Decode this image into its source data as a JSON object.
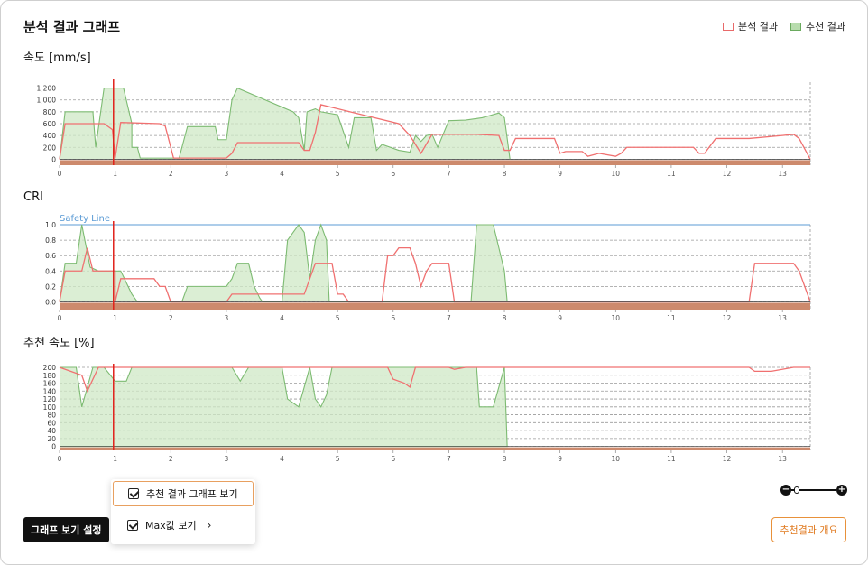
{
  "header": {
    "title": "분석 결과 그래프",
    "legend": [
      {
        "label": "분석 결과",
        "stroke": "#e86a6a",
        "fill": "#ffffff"
      },
      {
        "label": "추천 결과",
        "stroke": "#6aaa5e",
        "fill": "#b8dcae"
      }
    ]
  },
  "colors": {
    "analysis_line": "#f07070",
    "recommend_line": "#7dbb72",
    "recommend_fill": "#cfe8c6",
    "ground_band": "#cd8a6d",
    "cursor": "#e0201a",
    "safety_line": "#5b9bd5"
  },
  "charts": [
    {
      "label": "속도 [mm/s]",
      "xlim": [
        0,
        13.5
      ],
      "ylim": [
        -100,
        1300
      ],
      "yticks": [
        0,
        200,
        400,
        600,
        800,
        1000,
        1200
      ],
      "ytick_labels": [
        "0",
        "200",
        "400",
        "600",
        "800",
        "1,000",
        "1,200"
      ],
      "xticks": [
        0,
        1,
        2,
        3,
        4,
        5,
        6,
        7,
        8,
        9,
        10,
        11,
        12,
        13
      ],
      "cursor_x": 0.97,
      "band_bottom": -200,
      "recommend": [
        [
          0,
          0
        ],
        [
          0.1,
          800
        ],
        [
          0.6,
          800
        ],
        [
          0.65,
          200
        ],
        [
          0.8,
          1200
        ],
        [
          1.15,
          1200
        ],
        [
          1.3,
          600
        ],
        [
          1.3,
          200
        ],
        [
          1.4,
          200
        ],
        [
          1.45,
          20
        ],
        [
          2.15,
          20
        ],
        [
          2.3,
          550
        ],
        [
          2.8,
          550
        ],
        [
          2.85,
          330
        ],
        [
          3.0,
          330
        ],
        [
          3.1,
          1000
        ],
        [
          3.2,
          1200
        ],
        [
          4.2,
          800
        ],
        [
          4.3,
          700
        ],
        [
          4.4,
          150
        ],
        [
          4.45,
          800
        ],
        [
          4.6,
          850
        ],
        [
          4.7,
          800
        ],
        [
          5.0,
          750
        ],
        [
          5.2,
          200
        ],
        [
          5.3,
          700
        ],
        [
          5.6,
          700
        ],
        [
          5.7,
          150
        ],
        [
          5.8,
          250
        ],
        [
          6.1,
          150
        ],
        [
          6.3,
          120
        ],
        [
          6.4,
          400
        ],
        [
          6.5,
          300
        ],
        [
          6.6,
          400
        ],
        [
          6.7,
          420
        ],
        [
          6.8,
          200
        ],
        [
          7.0,
          650
        ],
        [
          7.3,
          660
        ],
        [
          7.6,
          700
        ],
        [
          7.9,
          780
        ],
        [
          8.0,
          700
        ],
        [
          8.1,
          0
        ]
      ],
      "analysis": [
        [
          0,
          0
        ],
        [
          0.1,
          600
        ],
        [
          0.8,
          600
        ],
        [
          0.95,
          500
        ],
        [
          1.0,
          20
        ],
        [
          1.1,
          620
        ],
        [
          1.8,
          600
        ],
        [
          1.9,
          560
        ],
        [
          2.0,
          200
        ],
        [
          2.05,
          20
        ],
        [
          3.0,
          20
        ],
        [
          3.1,
          100
        ],
        [
          3.2,
          280
        ],
        [
          4.3,
          280
        ],
        [
          4.4,
          150
        ],
        [
          4.5,
          150
        ],
        [
          4.6,
          450
        ],
        [
          4.7,
          920
        ],
        [
          6.1,
          600
        ],
        [
          6.3,
          400
        ],
        [
          6.5,
          100
        ],
        [
          6.7,
          420
        ],
        [
          7.5,
          420
        ],
        [
          7.9,
          400
        ],
        [
          8.0,
          150
        ],
        [
          8.1,
          150
        ],
        [
          8.2,
          350
        ],
        [
          8.9,
          350
        ],
        [
          9.0,
          100
        ],
        [
          9.1,
          130
        ],
        [
          9.4,
          130
        ],
        [
          9.5,
          50
        ],
        [
          9.7,
          100
        ],
        [
          10.0,
          50
        ],
        [
          10.1,
          100
        ],
        [
          10.2,
          200
        ],
        [
          10.9,
          200
        ],
        [
          11.4,
          200
        ],
        [
          11.5,
          100
        ],
        [
          11.6,
          100
        ],
        [
          11.8,
          350
        ],
        [
          12.4,
          350
        ],
        [
          13.0,
          400
        ],
        [
          13.2,
          420
        ],
        [
          13.3,
          350
        ],
        [
          13.5,
          0
        ]
      ]
    },
    {
      "label": "CRI",
      "xlim": [
        0,
        13.5
      ],
      "ylim": [
        -0.1,
        1.0
      ],
      "yticks": [
        0,
        0.2,
        0.4,
        0.6,
        0.8,
        1.0
      ],
      "ytick_labels": [
        "0.0",
        "0.2",
        "0.4",
        "0.6",
        "0.8",
        "1.0"
      ],
      "xticks": [
        0,
        1,
        2,
        3,
        4,
        5,
        6,
        7,
        8,
        9,
        10,
        11,
        12,
        13
      ],
      "cursor_x": 0.97,
      "band_bottom": -0.16,
      "safety_line": {
        "value": 1.0,
        "label": "Safety Line"
      },
      "recommend": [
        [
          0,
          0
        ],
        [
          0.1,
          0.5
        ],
        [
          0.3,
          0.5
        ],
        [
          0.4,
          1.0
        ],
        [
          0.55,
          0.45
        ],
        [
          0.7,
          0.4
        ],
        [
          1.1,
          0.4
        ],
        [
          1.3,
          0.1
        ],
        [
          1.4,
          0.0
        ],
        [
          2.2,
          0.0
        ],
        [
          2.3,
          0.2
        ],
        [
          3.0,
          0.2
        ],
        [
          3.1,
          0.3
        ],
        [
          3.2,
          0.5
        ],
        [
          3.4,
          0.5
        ],
        [
          3.5,
          0.2
        ],
        [
          3.6,
          0.05
        ],
        [
          3.65,
          0.0
        ],
        [
          4.0,
          0.0
        ],
        [
          4.1,
          0.8
        ],
        [
          4.3,
          1.0
        ],
        [
          4.4,
          0.9
        ],
        [
          4.5,
          0.3
        ],
        [
          4.6,
          0.8
        ],
        [
          4.7,
          1.0
        ],
        [
          4.8,
          0.8
        ],
        [
          4.85,
          0.0
        ],
        [
          7.4,
          0.0
        ],
        [
          7.5,
          1.0
        ],
        [
          7.8,
          1.0
        ],
        [
          8.0,
          0.4
        ],
        [
          8.05,
          0.0
        ]
      ],
      "analysis": [
        [
          0,
          0
        ],
        [
          0.1,
          0.4
        ],
        [
          0.4,
          0.4
        ],
        [
          0.5,
          0.7
        ],
        [
          0.6,
          0.4
        ],
        [
          1.0,
          0.4
        ],
        [
          1.0,
          0.0
        ],
        [
          1.1,
          0.3
        ],
        [
          1.7,
          0.3
        ],
        [
          1.8,
          0.2
        ],
        [
          1.9,
          0.2
        ],
        [
          2.0,
          0.0
        ],
        [
          3.0,
          0.0
        ],
        [
          3.1,
          0.1
        ],
        [
          4.4,
          0.1
        ],
        [
          4.5,
          0.3
        ],
        [
          4.6,
          0.5
        ],
        [
          4.9,
          0.5
        ],
        [
          5.0,
          0.1
        ],
        [
          5.1,
          0.1
        ],
        [
          5.2,
          0.0
        ],
        [
          5.8,
          0.0
        ],
        [
          5.9,
          0.6
        ],
        [
          6.0,
          0.6
        ],
        [
          6.1,
          0.7
        ],
        [
          6.3,
          0.7
        ],
        [
          6.4,
          0.5
        ],
        [
          6.5,
          0.2
        ],
        [
          6.6,
          0.4
        ],
        [
          6.7,
          0.5
        ],
        [
          7.0,
          0.5
        ],
        [
          7.1,
          0.0
        ],
        [
          12.4,
          0.0
        ],
        [
          12.5,
          0.5
        ],
        [
          13.2,
          0.5
        ],
        [
          13.3,
          0.4
        ],
        [
          13.4,
          0.2
        ],
        [
          13.5,
          0.0
        ]
      ]
    },
    {
      "label": "추천 속도 [%]",
      "xlim": [
        0,
        13.5
      ],
      "ylim": [
        -10,
        200
      ],
      "yticks": [
        0,
        20,
        40,
        60,
        80,
        100,
        120,
        140,
        160,
        180,
        200
      ],
      "ytick_labels": [
        "0",
        "20",
        "40",
        "60",
        "80",
        "100",
        "120",
        "140",
        "160",
        "180",
        "200"
      ],
      "xticks": [
        0,
        1,
        2,
        3,
        4,
        5,
        6,
        7,
        8,
        9,
        10,
        11,
        12,
        13
      ],
      "cursor_x": 0.97,
      "band_bottom": -35,
      "recommend": [
        [
          0,
          200
        ],
        [
          0.3,
          200
        ],
        [
          0.4,
          100
        ],
        [
          0.6,
          200
        ],
        [
          0.8,
          200
        ],
        [
          1.0,
          165
        ],
        [
          1.2,
          165
        ],
        [
          1.3,
          200
        ],
        [
          3.1,
          200
        ],
        [
          3.25,
          165
        ],
        [
          3.4,
          200
        ],
        [
          4.0,
          200
        ],
        [
          4.1,
          120
        ],
        [
          4.2,
          110
        ],
        [
          4.3,
          100
        ],
        [
          4.4,
          150
        ],
        [
          4.5,
          200
        ],
        [
          4.6,
          120
        ],
        [
          4.7,
          100
        ],
        [
          4.8,
          130
        ],
        [
          4.9,
          200
        ],
        [
          7.5,
          200
        ],
        [
          7.55,
          100
        ],
        [
          7.8,
          100
        ],
        [
          8.0,
          200
        ],
        [
          8.05,
          0
        ],
        [
          0,
          0
        ]
      ],
      "analysis": [
        [
          0,
          200
        ],
        [
          0.4,
          180
        ],
        [
          0.5,
          140
        ],
        [
          0.7,
          200
        ],
        [
          1.0,
          200
        ],
        [
          5.9,
          200
        ],
        [
          6.0,
          170
        ],
        [
          6.2,
          160
        ],
        [
          6.3,
          150
        ],
        [
          6.4,
          200
        ],
        [
          7.0,
          200
        ],
        [
          7.1,
          195
        ],
        [
          7.3,
          200
        ],
        [
          12.4,
          200
        ],
        [
          12.5,
          190
        ],
        [
          12.8,
          190
        ],
        [
          13.2,
          200
        ],
        [
          13.5,
          200
        ]
      ]
    }
  ],
  "controls": {
    "settings_button": "그래프 보기 설정",
    "menu_items": [
      "추천 결과 그래프 보기",
      "Max값 보기"
    ],
    "summary_button": "추천결과 개요"
  }
}
